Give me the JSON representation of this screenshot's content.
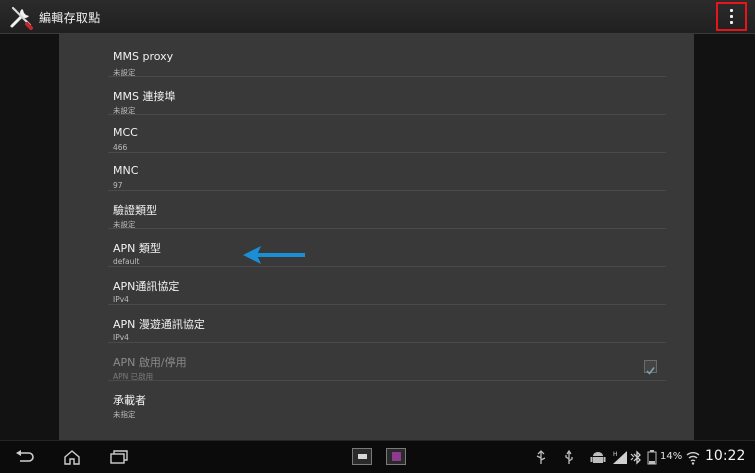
{
  "action_bar": {
    "title": "編輯存取點",
    "overflow_icon": "more-vert-icon",
    "highlight_color": "#e8141c"
  },
  "preferences": [
    {
      "title": "MMS proxy",
      "summary": "未設定"
    },
    {
      "title": "MMS 連接埠",
      "summary": "未設定"
    },
    {
      "title": "MCC",
      "summary": "466"
    },
    {
      "title": "MNC",
      "summary": "97"
    },
    {
      "title": "驗證類型",
      "summary": "未設定"
    },
    {
      "title": "APN 類型",
      "summary": "default"
    },
    {
      "title": "APN通訊協定",
      "summary": "IPv4"
    },
    {
      "title": "APN 漫遊通訊協定",
      "summary": "IPv4"
    },
    {
      "title": "APN 啟用/停用",
      "summary": "APN 已啟用",
      "disabled": true,
      "checked": true
    },
    {
      "title": "承載者",
      "summary": "未指定"
    }
  ],
  "annotation": {
    "arrow_color": "#1a8fd6",
    "points_to": "APN 類型"
  },
  "system_bar": {
    "battery": "14%",
    "time": "10:22"
  }
}
